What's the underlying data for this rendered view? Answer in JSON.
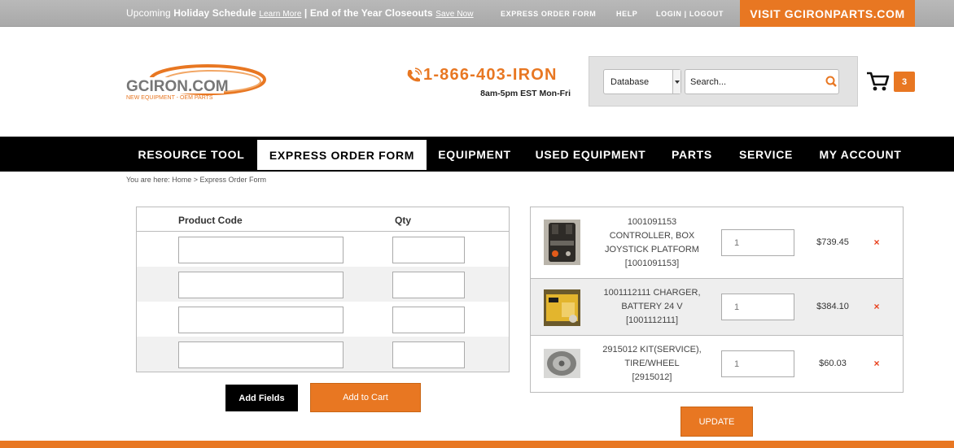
{
  "topbar": {
    "upcoming": "Upcoming",
    "holiday_schedule": "Holiday Schedule",
    "learn_more": "Learn More",
    "separator": "|",
    "closeouts": "End of the Year Closeouts",
    "save_now": "Save Now",
    "express_order_form": "EXPRESS ORDER FORM",
    "help": "HELP",
    "login_logout": "LOGIN | LOGOUT",
    "visit": "VISIT GCIRONPARTS.COM"
  },
  "logo": {
    "main": "GCIRON.COM",
    "tagline": "NEW EQUIPMENT - OEM PARTS"
  },
  "phone": {
    "number": "1-866-403-IRON",
    "hours": "8am-5pm EST Mon-Fri"
  },
  "search": {
    "select_value": "Database",
    "placeholder": "Search..."
  },
  "cart": {
    "count": "3"
  },
  "nav": {
    "items": [
      {
        "label": "RESOURCE TOOL"
      },
      {
        "label": "EXPRESS ORDER FORM"
      },
      {
        "label": "EQUIPMENT"
      },
      {
        "label": "USED EQUIPMENT"
      },
      {
        "label": "PARTS"
      },
      {
        "label": "SERVICE"
      },
      {
        "label": "MY ACCOUNT"
      }
    ]
  },
  "breadcrumb": "You are here: Home > Express Order Form",
  "form": {
    "col_product_code": "Product Code",
    "col_qty": "Qty",
    "add_fields": "Add Fields",
    "add_to_cart": "Add to Cart"
  },
  "cart_items": [
    {
      "desc_lines": [
        "1001091153",
        "CONTROLLER, BOX",
        "JOYSTICK PLATFORM",
        "[1001091153]"
      ],
      "qty_placeholder": "1",
      "price": "$739.45",
      "remove": "×"
    },
    {
      "desc_lines": [
        "1001112111 CHARGER,",
        "BATTERY 24 V",
        "[1001112111]"
      ],
      "qty_placeholder": "1",
      "price": "$384.10",
      "remove": "×"
    },
    {
      "desc_lines": [
        "2915012 KIT(SERVICE),",
        "TIRE/WHEEL",
        "[2915012]"
      ],
      "qty_placeholder": "1",
      "price": "$60.03",
      "remove": "×"
    }
  ],
  "update_label": "UPDATE",
  "colors": {
    "accent": "#e87722",
    "nav_bg": "#000000",
    "topbar_bg": "#b0b0b0"
  }
}
